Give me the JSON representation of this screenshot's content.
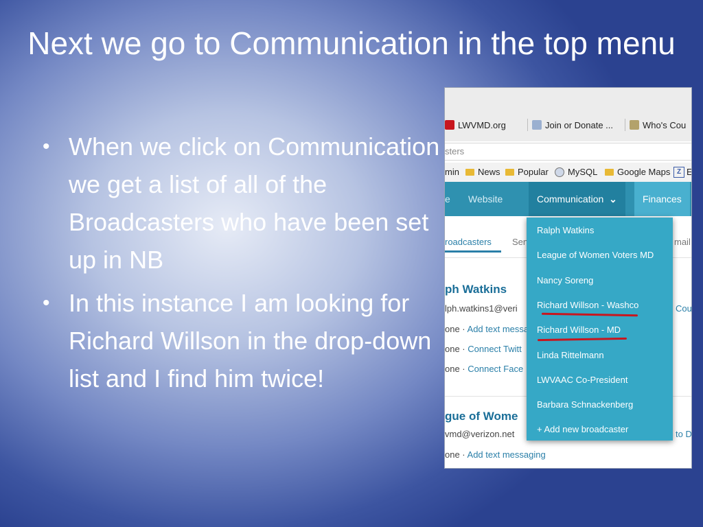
{
  "slide": {
    "title": "Next we go to Communication in the top menu",
    "bullets": [
      "When we click on Communication we get a list of all of the Broadcasters who have been set up in NB",
      "In this instance I am looking for Richard Willson in the drop-down list and I find him twice!"
    ],
    "bullet_symbol": "•"
  },
  "browser": {
    "tabs": [
      "LWVMD.org",
      "Join or Donate ...",
      "Who's Cou"
    ],
    "url": "sters",
    "bookmarks": [
      "min",
      "News",
      "Popular",
      "MySQL",
      "Google Maps",
      "Z",
      "E"
    ]
  },
  "nav": {
    "items": [
      "e",
      "Website",
      "Communication",
      "Finances"
    ],
    "communication_chevron": "⌄"
  },
  "page": {
    "subnav": [
      "roadcasters",
      "Sen",
      "mail"
    ],
    "name1": "ph Watkins",
    "email1": "lph.watkins1@veri",
    "link_cou": "Cou",
    "row1_prefix": "one · ",
    "row1_link": "Add text messa",
    "row2_prefix": "one · ",
    "row2_link": "Connect Twitt",
    "row3_prefix": "one · ",
    "row3_link": "Connect Face",
    "name2": "gue of Wome",
    "email2": "vmd@verizon.net",
    "link_tod": "to D",
    "row4_prefix": "one · ",
    "row4_link": "Add text messaging"
  },
  "dropdown": {
    "items": [
      "Ralph Watkins",
      "League of Women Voters MD",
      "Nancy Soreng",
      "Richard Willson - Washco",
      "Richard Willson - MD",
      "Linda Rittelmann",
      "LWVAAC Co-President",
      "Barbara Schnackenberg",
      "+ Add new broadcaster"
    ]
  },
  "colors": {
    "nav_bg": "#2f91b0",
    "dropdown_bg": "#36a8c6",
    "annotation_red": "#c8161e"
  }
}
